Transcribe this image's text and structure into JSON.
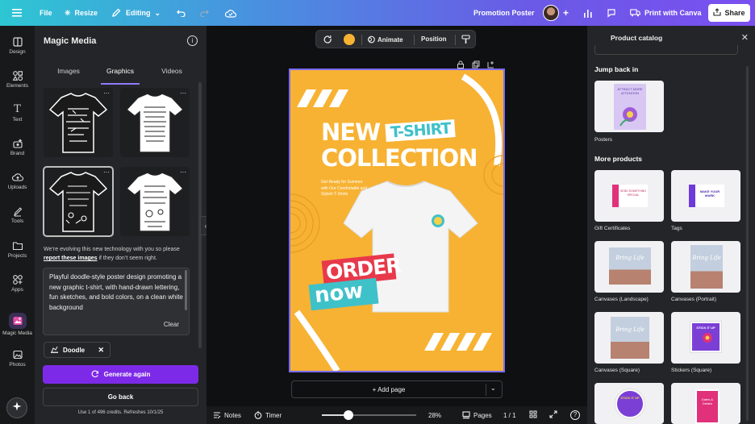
{
  "topbar": {
    "file": "File",
    "resize": "Resize",
    "mode": "Editing",
    "doc_title": "Promotion Poster",
    "print": "Print with Canva",
    "share": "Share"
  },
  "rail": [
    {
      "label": "Design",
      "icon": "design-icon"
    },
    {
      "label": "Elements",
      "icon": "elements-icon"
    },
    {
      "label": "Text",
      "icon": "text-icon"
    },
    {
      "label": "Brand",
      "icon": "brand-icon"
    },
    {
      "label": "Uploads",
      "icon": "uploads-icon"
    },
    {
      "label": "Tools",
      "icon": "tools-icon"
    },
    {
      "label": "Projects",
      "icon": "projects-icon"
    },
    {
      "label": "Apps",
      "icon": "apps-icon"
    },
    {
      "label": "Magic Media",
      "icon": "magic-media-icon"
    },
    {
      "label": "Photos",
      "icon": "photos-icon"
    }
  ],
  "panel": {
    "title": "Magic Media",
    "tabs": [
      "Images",
      "Graphics",
      "Videos"
    ],
    "active_tab": "Graphics",
    "notice_pre": "We’re evolving this new technology with you so please ",
    "notice_link": "report these images",
    "notice_post": " if they don’t seem right.",
    "prompt": "Playful doodle-style poster design promoting a new graphic t-shirt, with hand-drawn lettering, fun sketches, and bold colors, on a clean white background",
    "clear": "Clear",
    "style_chip": "Doodle",
    "generate": "Generate again",
    "back": "Go back",
    "credits": "Use 1 of 496 credits. Refreshes 10/1/25"
  },
  "toolbar": {
    "animate": "Animate",
    "position": "Position",
    "color": "#f7b233"
  },
  "poster": {
    "title_line1": "NEW",
    "title_tag": "T-SHIRT",
    "title_line2": "COLLECTION",
    "subtitle": "Get Ready for Summer with Our Comfortable and Stylish T-Shirts",
    "order": "ORDER",
    "now": "now",
    "bg_color": "#f7b233",
    "accent_color": "#3fc1c9"
  },
  "bottom": {
    "add_page": "+ Add page",
    "notes": "Notes",
    "timer": "Timer",
    "zoom": "28%",
    "zoom_level": 0.28,
    "pages": "Pages",
    "page_count": "1 / 1"
  },
  "catalog": {
    "title": "Product catalog",
    "jump_back": "Jump back in",
    "posters": "Posters",
    "more_products": "More products",
    "items": [
      {
        "label": "Gift Certificates"
      },
      {
        "label": "Tags"
      },
      {
        "label": "Canvases (Landscape)"
      },
      {
        "label": "Canvases (Portrait)"
      },
      {
        "label": "Canvases (Square)"
      },
      {
        "label": "Stickers (Square)"
      }
    ],
    "card_texts": {
      "poster_card": "ATTRACT MORE ATTENTION",
      "gift": "SEND SOMETHING SPECIAL",
      "tag": "MAKE YOUR MARK",
      "canvas": "Bring Life",
      "sticker": "STICK IT UP",
      "sticker2": "STICK IT UP",
      "card_last": "Dates & Details"
    }
  }
}
